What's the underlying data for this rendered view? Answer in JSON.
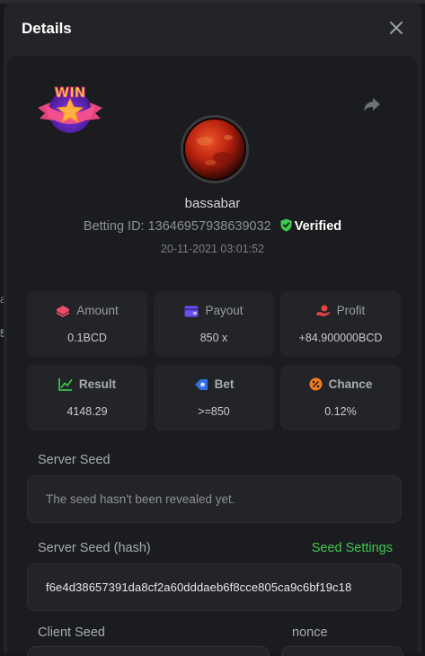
{
  "dialog": {
    "title": "Details"
  },
  "player": {
    "username": "bassabar",
    "betting_id_label": "Betting ID:",
    "betting_id": "13646957938639032",
    "verified_label": "Verified",
    "timestamp": "20-11-2021 03:01:52",
    "badge_text": "WIN"
  },
  "stats": [
    {
      "label": "Amount",
      "value": "0.1BCD",
      "icon": "coins-icon",
      "color": "#ec4c6c"
    },
    {
      "label": "Payout",
      "value": "850 x",
      "icon": "wallet-icon",
      "color": "#6b4ef0"
    },
    {
      "label": "Profit",
      "value": "+84.900000BCD",
      "icon": "hand-coin-icon",
      "color": "#e94545"
    },
    {
      "label": "Result",
      "value": "4148.29",
      "icon": "chart-check-icon",
      "color": "#39c24b"
    },
    {
      "label": "Bet",
      "value": ">=850",
      "icon": "target-icon",
      "color": "#2f6fe8"
    },
    {
      "label": "Chance",
      "value": "0.12%",
      "icon": "percent-icon",
      "color": "#f07a1e"
    }
  ],
  "seeds": {
    "server_seed_label": "Server Seed",
    "server_seed_value": "The seed hasn't been revealed yet.",
    "server_hash_label": "Server Seed (hash)",
    "seed_settings_link": "Seed Settings",
    "server_hash_value": "f6e4d38657391da8cf2a60dddaeb6f8cce805ca9c6bf19c18",
    "client_seed_label": "Client Seed",
    "nonce_label": "nonce"
  },
  "colors": {
    "accent": "#3fc94f",
    "background": "#1b1c1f",
    "card": "#232427"
  },
  "side": {
    "glyph_1": "ay",
    "glyph_2": "5"
  }
}
